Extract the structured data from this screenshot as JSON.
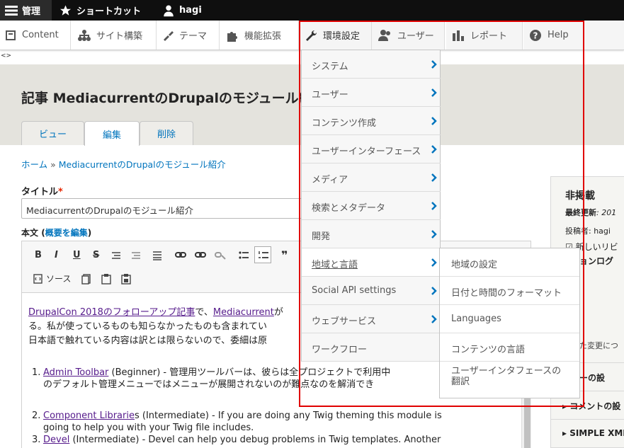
{
  "toolbar": {
    "admin": "管理",
    "shortcut": "ショートカット",
    "user": "hagi"
  },
  "tray": {
    "content": "Content",
    "structure": "サイト構築",
    "appearance": "テーマ",
    "extend": "機能拡張",
    "config": "環境設定",
    "users": "ユーザー",
    "reports": "レポート",
    "help": "Help"
  },
  "tray_arrows": "<>",
  "page": {
    "title": "記事 MediacurrentのDrupalのモジュール紹介",
    "tabs": {
      "view": "ビュー",
      "edit": "編集",
      "delete": "削除"
    },
    "breadcrumb_home": "ホーム",
    "breadcrumb_sep": "»",
    "breadcrumb_current": "MediacurrentのDrupalのモジュール紹介",
    "title_label": "タイトル",
    "required_mark": "*",
    "title_value": "MediacurrentのDrupalのモジュール紹介",
    "body_label": "本文",
    "body_summary_link": "概要を編集",
    "source_label": "ソース"
  },
  "editor": {
    "p1_link1": "DrupalCon 2018のフォローアップ記事",
    "p1_text1": "で、",
    "p1_link2": "Mediacurrent",
    "p1_text2": "が",
    "p1_line2": "る。私が使っているものも知らなかったものも含まれてい",
    "p1_line3": "日本語で触れている内容は訳とは限らないので、委細は原",
    "items": [
      {
        "num": "1.",
        "link": "Admin Toolbar",
        "text": " (Beginner) - 管理用ツールバーは、彼らは全プロジェクトで利用中",
        "line2": "のデフォルト管理メニューではメニューが展開されないのが難点なのを解消でき"
      },
      {
        "num": "2.",
        "link": "Component Librarie",
        "text": "s (Intermediate) - If you are doing any Twig theming this module is",
        "line2": "going to help you with your Twig file includes."
      },
      {
        "num": "3.",
        "link": "Devel",
        "text": " (Intermediate) - Devel can help you debug problems in Twig templates. Another",
        "line2": ""
      }
    ]
  },
  "sidebar": {
    "status": "非掲載",
    "updated_label": "最終更新",
    "updated_value": ": 201",
    "author": "投稿者: hagi",
    "revision": "新しいリビ",
    "revision_log": "ジョンログ",
    "change_note": "た変更につ",
    "menu_section": "ニューの設",
    "comment_section": "▸ コメントの設",
    "xml_section": "▸ SIMPLE XML"
  },
  "config_menu": {
    "items": [
      "システム",
      "ユーザー",
      "コンテンツ作成",
      "ユーザーインターフェース",
      "メディア",
      "検索とメタデータ",
      "開発",
      "地域と言語",
      "Social API settings",
      "ウェブサービス",
      "ワークフロー"
    ],
    "submenu": [
      "地域の設定",
      "日付と時間のフォーマット",
      "Languages",
      "コンテンツの言語",
      "ユーザーインタフェースの",
      "翻訳"
    ]
  },
  "colors": {
    "accent": "#0074bd",
    "highlight": "#e00000",
    "toolbar": "#0f0f0f"
  }
}
